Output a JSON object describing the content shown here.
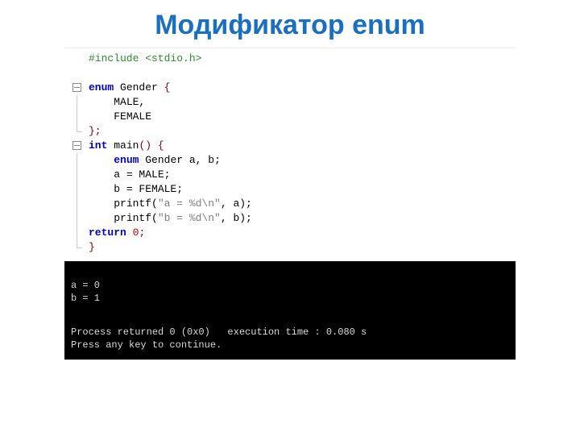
{
  "title": "Модификатор enum",
  "code": {
    "include": "#include <stdio.h>",
    "enum_decl_open": {
      "kw": "enum",
      "name": "Gender",
      "brace": "{"
    },
    "enum_vals": [
      "MALE,",
      "FEMALE"
    ],
    "enum_close": "};",
    "main_decl": {
      "kw_int": "int",
      "name": "main",
      "paren": "()",
      "brace": "{"
    },
    "body": {
      "decl": {
        "kw": "enum",
        "type": "Gender",
        "vars": "a, b;"
      },
      "assign_a": "a = MALE;",
      "assign_b": "b = FEMALE;",
      "printf_a": {
        "call": "printf(",
        "str": "\"a = %d\\n\"",
        "rest": ", a);"
      },
      "printf_b": {
        "call": "printf(",
        "str": "\"b = %d\\n\"",
        "rest": ", b);"
      },
      "return": {
        "kw": "return",
        "val": "0",
        "semi": ";"
      }
    },
    "main_close": "}"
  },
  "console": {
    "line1": "a = 0",
    "line2": "b = 1",
    "line3": "Process returned 0 (0x0)   execution time : 0.080 s",
    "line4": "Press any key to continue."
  }
}
